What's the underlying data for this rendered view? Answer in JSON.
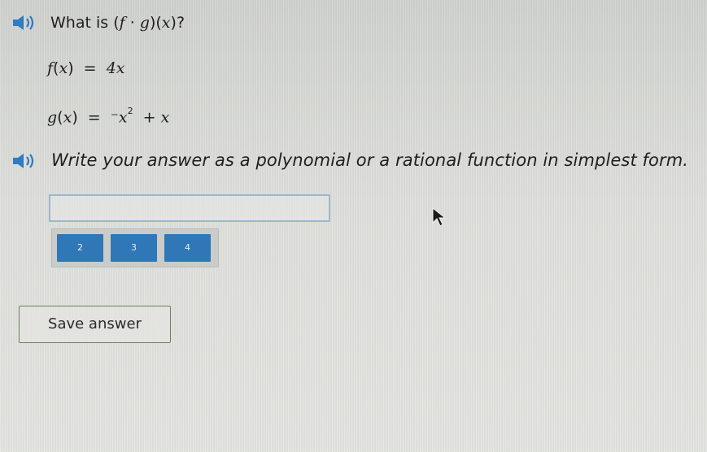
{
  "question": {
    "prefix": "What is ",
    "expression_f": "f",
    "expression_dot": "·",
    "expression_g": "g",
    "expression_x": "x",
    "suffix": "?"
  },
  "functions": [
    {
      "name": "f",
      "arg": "x",
      "rhs": "4x"
    },
    {
      "name": "g",
      "arg": "x",
      "rhs_minus": "⁻",
      "rhs_var": "x",
      "rhs_exp": "2",
      "rhs_tail": "+ x"
    }
  ],
  "instruction": "Write your answer as a polynomial or a rational function in simplest form.",
  "answer_input": {
    "value": "",
    "placeholder": ""
  },
  "keypad": {
    "keys": [
      "2",
      "3",
      "4"
    ]
  },
  "save_button": "Save answer",
  "icons": {
    "audio": "speaker-icon",
    "cursor": "mouse-pointer-icon"
  },
  "colors": {
    "speaker_blue": "#2f7bc4",
    "key_blue": "#2f77b6",
    "input_border": "#9fb6cf",
    "button_border": "#6f8060"
  }
}
